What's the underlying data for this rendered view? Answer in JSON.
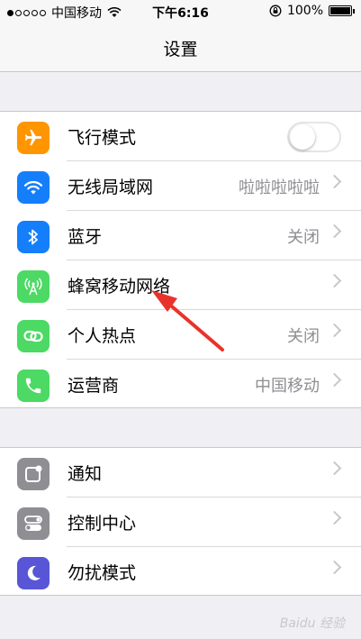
{
  "status_bar": {
    "carrier": "中国移动",
    "time": "下午6:16",
    "battery": "100%",
    "signal_bars_filled": 1,
    "signal_bars_total": 5
  },
  "nav": {
    "title": "设置"
  },
  "group1": [
    {
      "id": "airplane",
      "label": "飞行模式",
      "icon": "airplane-icon",
      "color": "#ff9500",
      "toggle_on": false
    },
    {
      "id": "wifi",
      "label": "无线局域网",
      "detail": "啦啦啦啦啦",
      "icon": "wifi-icon",
      "color": "#147efb"
    },
    {
      "id": "bluetooth",
      "label": "蓝牙",
      "detail": "关闭",
      "icon": "bluetooth-icon",
      "color": "#147efb"
    },
    {
      "id": "cellular",
      "label": "蜂窝移动网络",
      "icon": "cellular-icon",
      "color": "#4cd964"
    },
    {
      "id": "hotspot",
      "label": "个人热点",
      "detail": "关闭",
      "icon": "hotspot-icon",
      "color": "#4cd964"
    },
    {
      "id": "carrier",
      "label": "运营商",
      "detail": "中国移动",
      "icon": "phone-icon",
      "color": "#4cd964"
    }
  ],
  "group2": [
    {
      "id": "notifications",
      "label": "通知",
      "icon": "notifications-icon",
      "color": "#8e8e93"
    },
    {
      "id": "control-center",
      "label": "控制中心",
      "icon": "control-center-icon",
      "color": "#8e8e93"
    },
    {
      "id": "do-not-disturb",
      "label": "勿扰模式",
      "icon": "moon-icon",
      "color": "#5856d6"
    }
  ],
  "watermark": "Baidu 经验"
}
